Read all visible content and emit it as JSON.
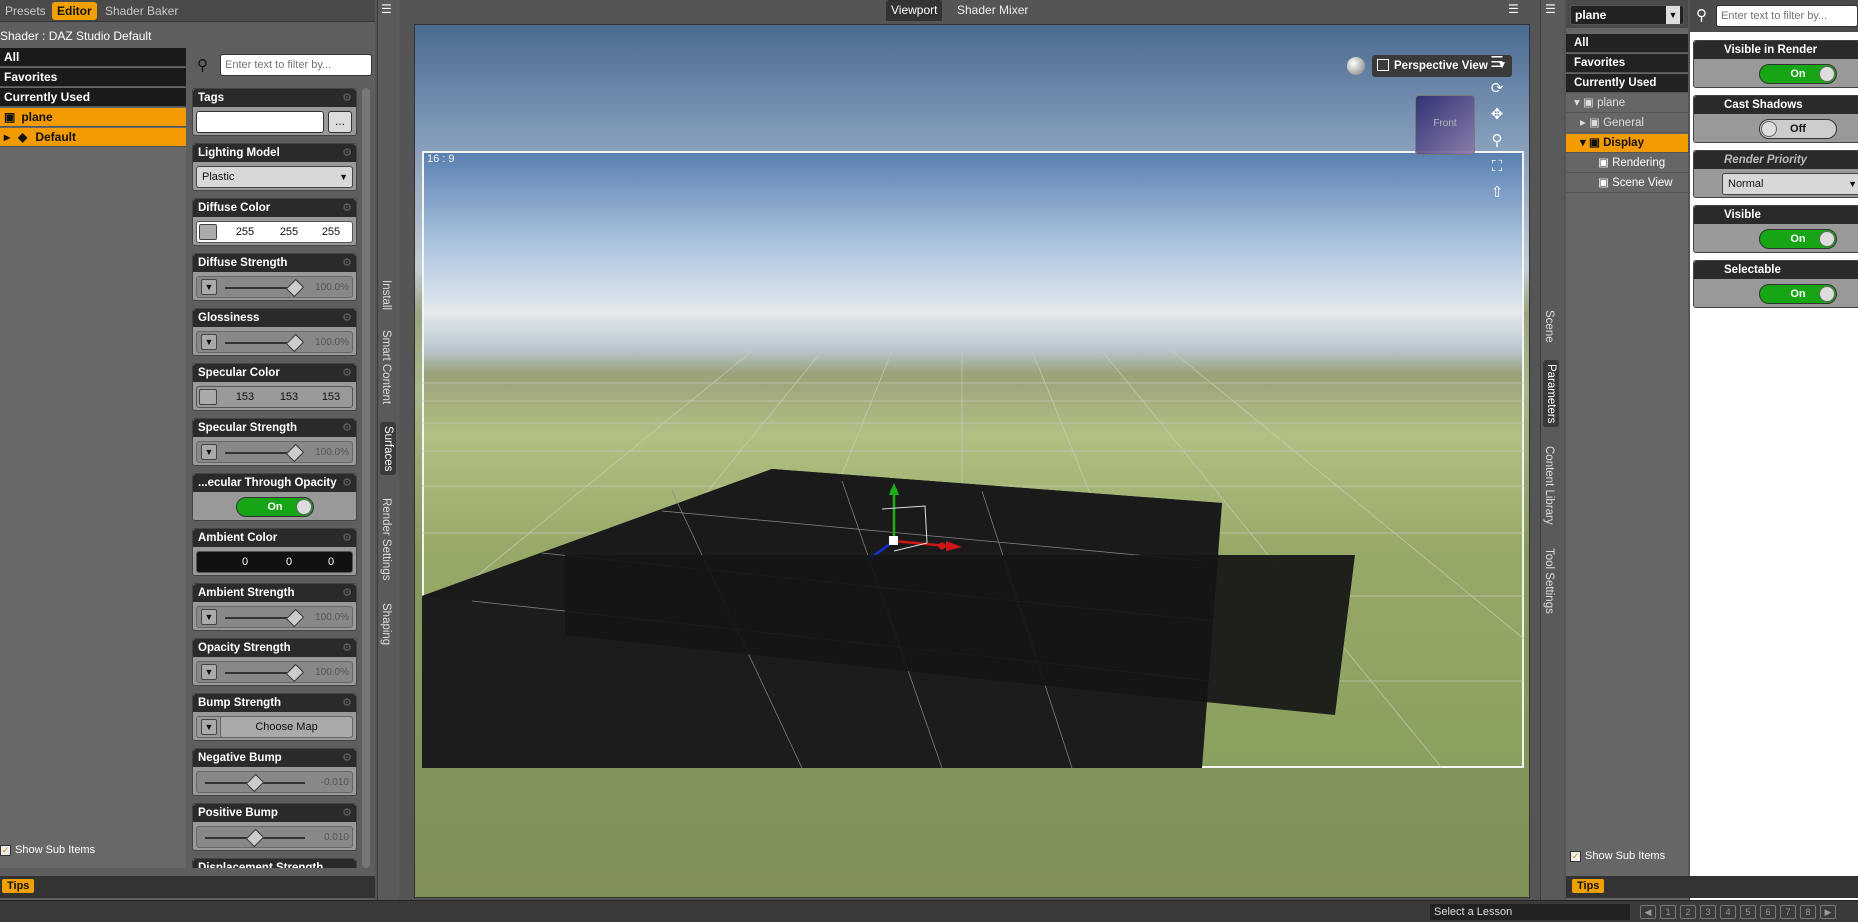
{
  "left": {
    "tabs": [
      {
        "label": "Presets"
      },
      {
        "label": "Editor",
        "active": true
      },
      {
        "label": "Shader Baker"
      }
    ],
    "shader_label": "Shader : DAZ Studio Default",
    "filter_placeholder": "Enter text to filter by...",
    "tree": [
      {
        "label": "All"
      },
      {
        "label": "Favorites"
      },
      {
        "label": "Currently Used"
      },
      {
        "label": "plane",
        "selected": true
      },
      {
        "label": "Default",
        "selected": true
      }
    ],
    "show_sub_items": "Show Sub Items",
    "tips": "Tips",
    "side_tabs": [
      "Install",
      "Smart Content",
      "Surfaces",
      "Render Settings",
      "Shaping"
    ],
    "props": {
      "tags": {
        "title": "Tags",
        "button": "..."
      },
      "lighting_model": {
        "title": "Lighting Model",
        "value": "Plastic"
      },
      "diffuse_color": {
        "title": "Diffuse Color",
        "r": "255",
        "g": "255",
        "b": "255"
      },
      "diffuse_strength": {
        "title": "Diffuse Strength",
        "value": "100.0%"
      },
      "glossiness": {
        "title": "Glossiness",
        "value": "100.0%"
      },
      "specular_color": {
        "title": "Specular Color",
        "r": "153",
        "g": "153",
        "b": "153"
      },
      "specular_strength": {
        "title": "Specular Strength",
        "value": "100.0%"
      },
      "specular_through_opacity": {
        "title": "...ecular Through Opacity",
        "value": "On"
      },
      "ambient_color": {
        "title": "Ambient Color",
        "r": "0",
        "g": "0",
        "b": "0"
      },
      "ambient_strength": {
        "title": "Ambient Strength",
        "value": "100.0%"
      },
      "opacity_strength": {
        "title": "Opacity Strength",
        "value": "100.0%"
      },
      "bump_strength": {
        "title": "Bump Strength",
        "button": "Choose Map"
      },
      "negative_bump": {
        "title": "Negative Bump",
        "value": "-0.010"
      },
      "positive_bump": {
        "title": "Positive Bump",
        "value": "0.010"
      },
      "displacement_strength": {
        "title": "Displacement Strength"
      }
    }
  },
  "center": {
    "tabs": [
      {
        "label": "Viewport",
        "active": true
      },
      {
        "label": "Shader Mixer"
      }
    ],
    "aspect_label": "16 : 9",
    "view_label": "Perspective View",
    "cube_label": "Front"
  },
  "right": {
    "node_select": "plane",
    "filter_placeholder": "Enter text to filter by...",
    "side_tabs": [
      "Scene",
      "Parameters",
      "Content Library",
      "Tool Settings"
    ],
    "tree": [
      {
        "label": "All"
      },
      {
        "label": "Favorites"
      },
      {
        "label": "Currently Used"
      },
      {
        "label": "plane"
      },
      {
        "label": "General"
      },
      {
        "label": "Display",
        "selected": true
      },
      {
        "label": "Rendering"
      },
      {
        "label": "Scene View"
      }
    ],
    "show_sub_items": "Show Sub Items",
    "tips": "Tips",
    "params": {
      "visible_in_render": {
        "title": "Visible in Render",
        "value": "On"
      },
      "cast_shadows": {
        "title": "Cast Shadows",
        "value": "Off"
      },
      "render_priority": {
        "title": "Render Priority",
        "value": "Normal"
      },
      "visible": {
        "title": "Visible",
        "value": "On"
      },
      "selectable": {
        "title": "Selectable",
        "value": "On"
      }
    }
  },
  "bottom": {
    "lesson_select": "Select a Lesson",
    "pages": [
      "1",
      "2",
      "3",
      "4",
      "5",
      "6",
      "7",
      "8"
    ]
  },
  "colors": {
    "accent": "#f39b00",
    "toggle_on": "#15a515",
    "panel_dark": "#2a2a2a"
  }
}
